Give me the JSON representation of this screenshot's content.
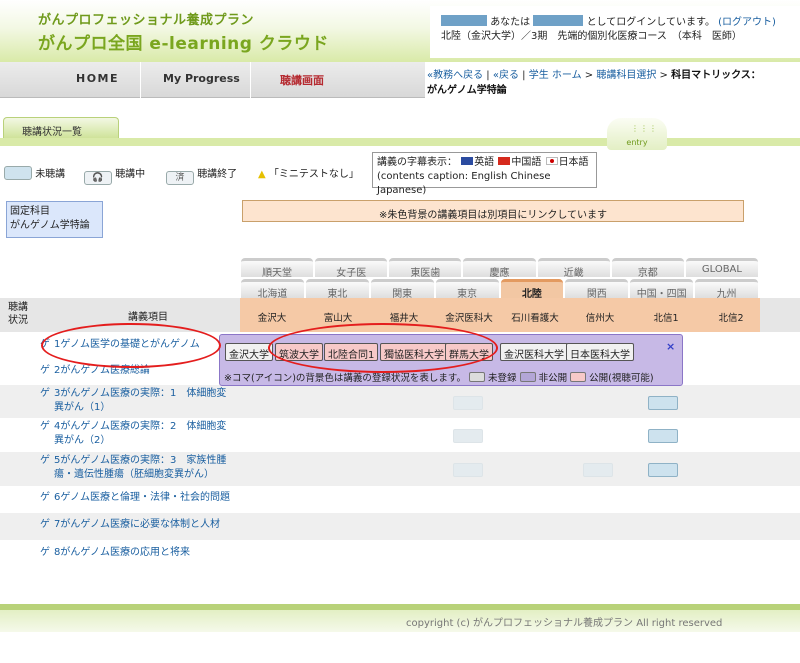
{
  "header": {
    "subtitle": "がんプロフェッショナル養成プラン",
    "title": "がんプロ全国 e-learning クラウド",
    "user_line1_a": "あなたは",
    "user_line1_b": "としてログインしています。",
    "logout": "(ログアウト)",
    "user_line2": "北陸（金沢大学）／3期　先端的個別化医療コース　（本科　医師）"
  },
  "nav": {
    "home": "HOME",
    "progress": "My Progress",
    "lecture": "聴講画面"
  },
  "breadcrumb": {
    "back_teacher": "«教務へ戻る",
    "back": "«戻る",
    "student_home": "学生 ホーム",
    "course_select": "聴講科目選択",
    "current": "科目マトリックス：",
    "current2": "がんゲノム学特論"
  },
  "status_tab": "聴講状況一覧",
  "entry": "entry",
  "legend": {
    "unviewed": "未聴講",
    "viewing": "聴講中",
    "done_chip": "済",
    "done": "聴講終了",
    "no_test": "「ミニテストなし」",
    "no_test_mark": "▲"
  },
  "captions": {
    "line1": "講義の字幕表示：",
    "en": "英語",
    "zh": "中国語",
    "ja": "日本語",
    "line2": "(contents caption: English Chinese  Japanese)"
  },
  "fixed_course": {
    "label": "固定科目",
    "name": "がんゲノム学特論"
  },
  "note": "※朱色背景の講義項目は別項目にリンクしています",
  "region_tabs_row1": [
    "順天堂",
    "女子医",
    "東医歯",
    "慶應",
    "近畿",
    "京都",
    "GLOBAL"
  ],
  "region_tabs_row2": [
    "北海道",
    "東北",
    "関東",
    "東京",
    "北陸",
    "関西",
    "中国・四国",
    "九州"
  ],
  "active_region": "北陸",
  "table": {
    "status_header": "聴講\n状況",
    "item_header": "講義項目",
    "universities": [
      "金沢大",
      "富山大",
      "福井大",
      "金沢医科大",
      "石川看護大",
      "信州大",
      "北信1",
      "北信2"
    ],
    "rows": [
      {
        "ge": "ゲ",
        "title": "1ゲノム医学の基礎とがんゲノム"
      },
      {
        "ge": "ゲ",
        "title": "2がんゲノム医療総論"
      },
      {
        "ge": "ゲ",
        "title": "3がんゲノム医療の実際：1　体細胞変\n異がん（1）"
      },
      {
        "ge": "ゲ",
        "title": "4がんゲノム医療の実際：2　体細胞変\n異がん（2）"
      },
      {
        "ge": "ゲ",
        "title": "5がんゲノム医療の実際：3　家族性腫\n瘍・遺伝性腫瘍（胚細胞変異がん）"
      },
      {
        "ge": "ゲ",
        "title": "6ゲノム医療と倫理・法律・社会的問題"
      },
      {
        "ge": "ゲ",
        "title": "7がんゲノム医療に必要な体制と人材"
      },
      {
        "ge": "ゲ",
        "title": "8がんゲノム医療の応用と将来"
      }
    ]
  },
  "popup": {
    "buttons": [
      "金沢大学",
      "筑波大学",
      "北陸合同1",
      "獨協医科大学",
      "群馬大学",
      "金沢医科大学",
      "日本医科大学"
    ],
    "close": "×",
    "note": "※コマ(アイコン)の背景色は講義の登録状況を表します。",
    "unregistered": "未登録",
    "private": "非公開",
    "public": "公開(視聴可能)"
  },
  "footer": "copyright (c) がんプロフェッショナル養成プラン All right reserved"
}
